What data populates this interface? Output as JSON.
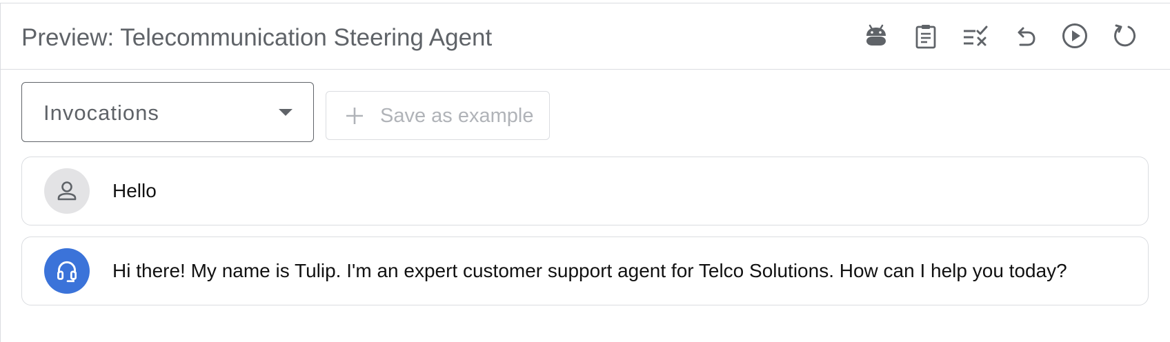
{
  "header": {
    "title": "Preview: Telecommunication Steering Agent",
    "toolbar_icons": [
      "android-icon",
      "clipboard-icon",
      "playlist-remove-icon",
      "undo-icon",
      "play-circle-icon",
      "refresh-icon"
    ]
  },
  "controls": {
    "invocations_select": {
      "value": "Invocations"
    },
    "save_button": {
      "label": "Save as example",
      "enabled": false
    }
  },
  "conversation": {
    "messages": [
      {
        "role": "user",
        "icon": "person-icon",
        "text": "Hello"
      },
      {
        "role": "agent",
        "icon": "headset-icon",
        "text": "Hi there! My name is Tulip. I'm an expert customer support agent for Telco Solutions. How can I help you today?"
      }
    ]
  },
  "colors": {
    "title_gray": "#5f6368",
    "icon_gray": "#5f6368",
    "border": "#dadce0",
    "disabled_text": "#b0b3b8",
    "agent_avatar_bg": "#3b73d9",
    "user_avatar_bg": "#e3e3e5"
  }
}
